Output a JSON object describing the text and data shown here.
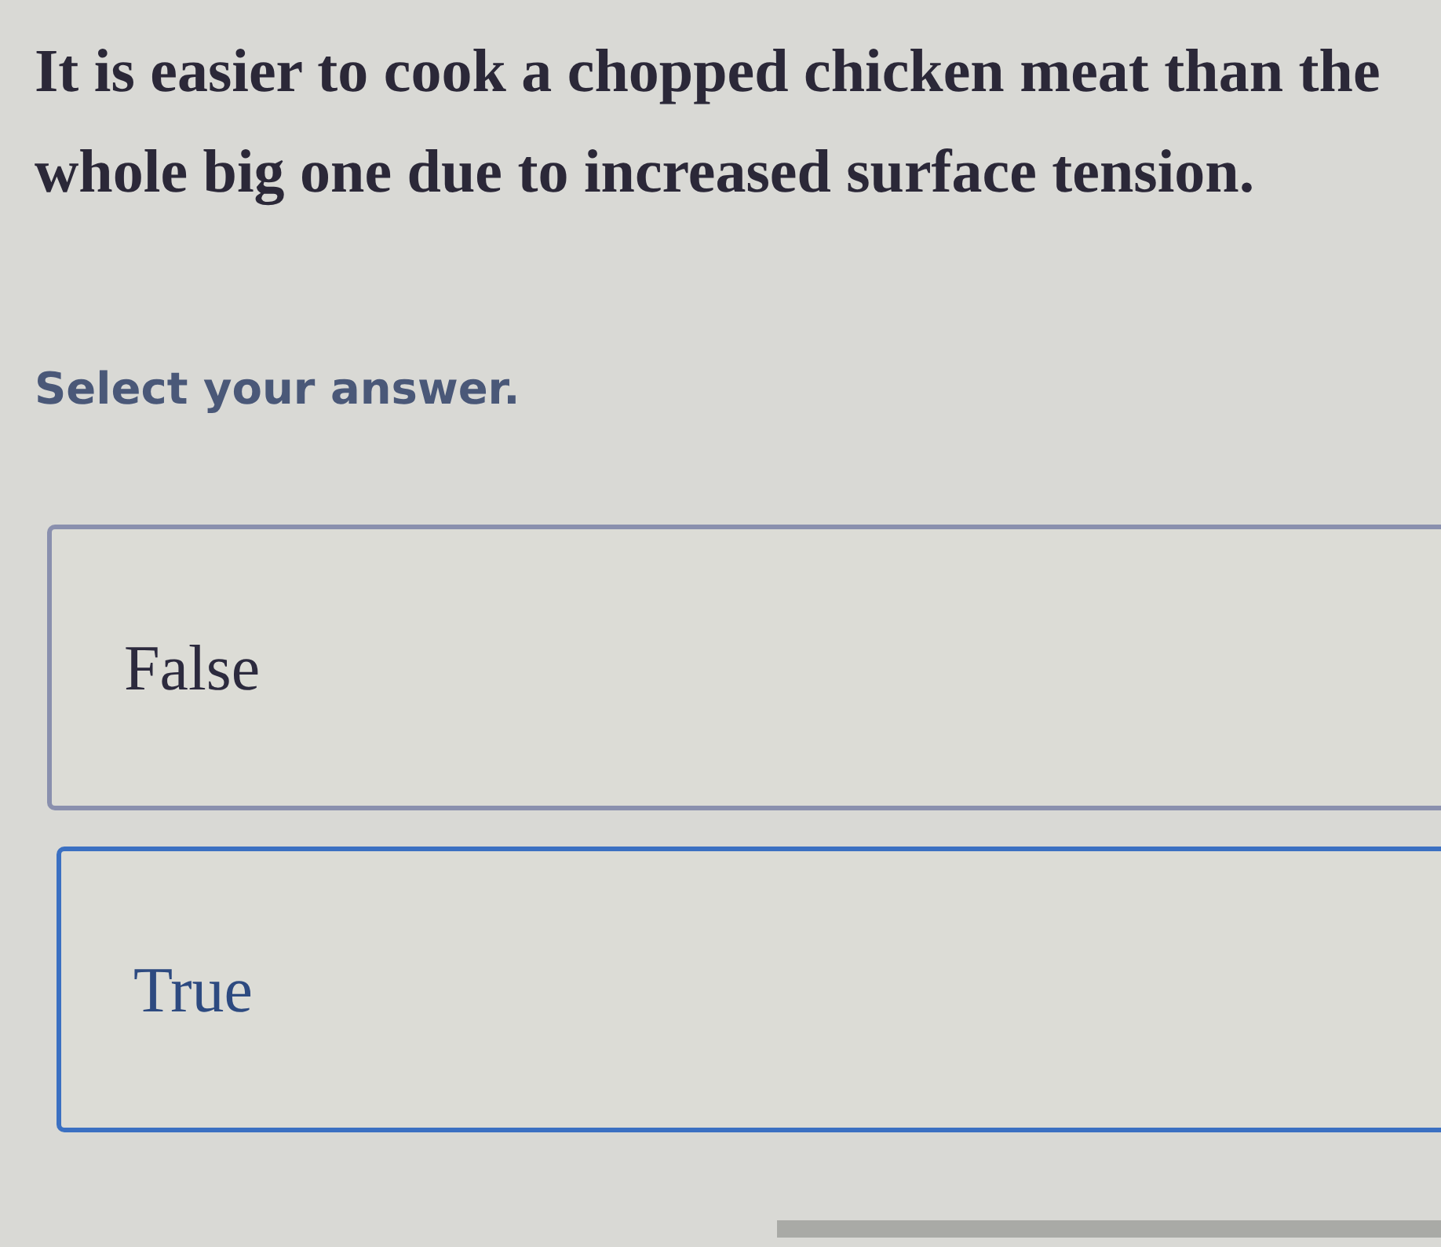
{
  "question": {
    "text": "It is easier to cook a chopped chicken meat than the whole big one due to increased surface tension."
  },
  "prompt": "Select your answer.",
  "options": [
    {
      "label": "False",
      "selected": false
    },
    {
      "label": "True",
      "selected": true
    }
  ]
}
